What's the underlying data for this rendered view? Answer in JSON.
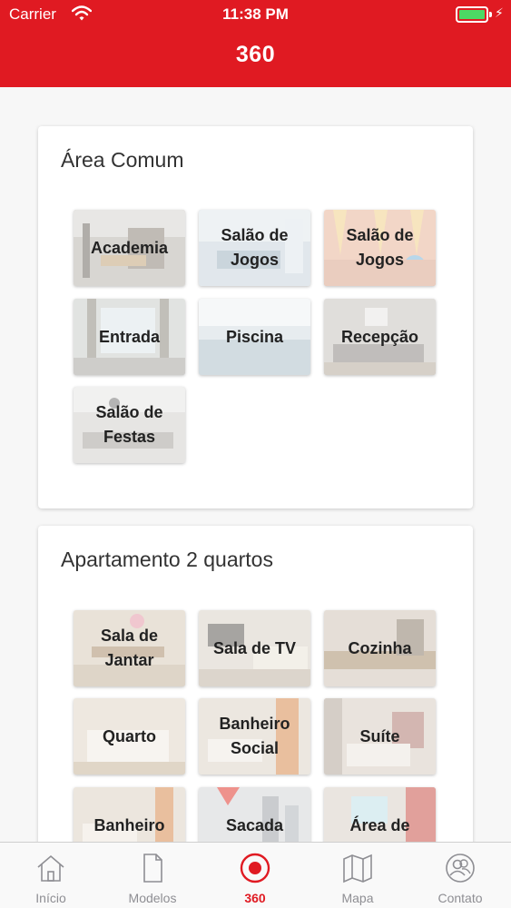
{
  "status_bar": {
    "carrier": "Carrier",
    "time": "11:38 PM"
  },
  "header": {
    "title": "360"
  },
  "sections": [
    {
      "title": "Área Comum",
      "tiles": [
        {
          "label": "Academia"
        },
        {
          "label": "Salão de Jogos"
        },
        {
          "label": "Salão de Jogos"
        },
        {
          "label": "Entrada"
        },
        {
          "label": "Piscina"
        },
        {
          "label": "Recepção"
        },
        {
          "label": "Salão de Festas"
        }
      ]
    },
    {
      "title": "Apartamento 2 quartos",
      "tiles": [
        {
          "label": "Sala de Jantar"
        },
        {
          "label": "Sala de TV"
        },
        {
          "label": "Cozinha"
        },
        {
          "label": "Quarto"
        },
        {
          "label": "Banheiro Social"
        },
        {
          "label": "Suíte"
        },
        {
          "label": "Banheiro"
        },
        {
          "label": "Sacada"
        },
        {
          "label": "Área de"
        }
      ]
    }
  ],
  "tabbar": {
    "items": [
      {
        "label": "Início",
        "icon": "home-icon"
      },
      {
        "label": "Modelos",
        "icon": "document-icon"
      },
      {
        "label": "360",
        "icon": "360-record-icon",
        "active": true
      },
      {
        "label": "Mapa",
        "icon": "map-icon"
      },
      {
        "label": "Contato",
        "icon": "contacts-icon"
      }
    ]
  },
  "colors": {
    "brand": "#e01a22",
    "inactive": "#8e8e93",
    "battery": "#4cd964"
  }
}
